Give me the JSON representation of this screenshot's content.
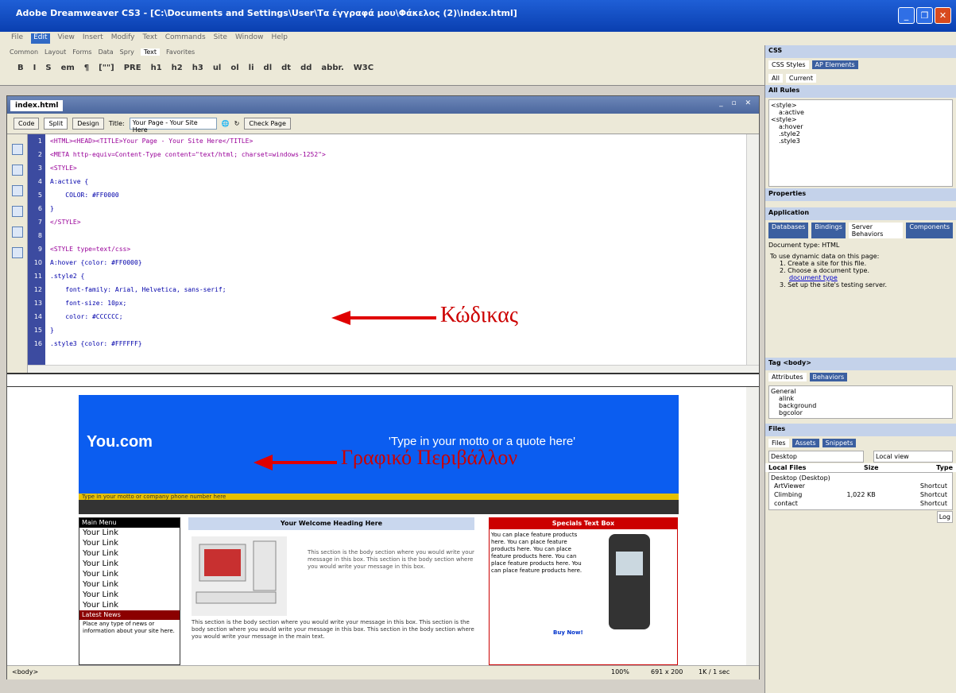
{
  "window": {
    "title": "Adobe Dreamweaver CS3 - [C:\\Documents and Settings\\User\\Τα έγγραφά μου\\Φάκελος (2)\\index.html]"
  },
  "menu": [
    "File",
    "Edit",
    "View",
    "Insert",
    "Modify",
    "Text",
    "Commands",
    "Site",
    "Window",
    "Help"
  ],
  "insert_tabs": [
    "Common",
    "Layout",
    "Forms",
    "Data",
    "Spry",
    "Text",
    "Favorites"
  ],
  "format_buttons": [
    "B",
    "I",
    "S",
    "em",
    "¶",
    "[\"\"]",
    "PRE",
    "h1",
    "h2",
    "h3",
    "ul",
    "ol",
    "li",
    "dl",
    "dt",
    "dd",
    "abbr.",
    "W3C"
  ],
  "document": {
    "tab": "index.html",
    "views": [
      "Code",
      "Split",
      "Design"
    ],
    "title_label": "Title:",
    "title_value": "Your Page - Your Site Here",
    "check_page": "Check Page"
  },
  "code": {
    "line_numbers": [
      "1",
      "2",
      "3",
      "4",
      "5",
      "6",
      "7",
      "8",
      "9",
      "10",
      "11",
      "12",
      "13",
      "14",
      "15",
      "16"
    ],
    "lines": [
      "<HTML><HEAD><TITLE>Your Page - Your Site Here</TITLE>",
      "<META http-equiv=Content-Type content=\"text/html; charset=windows-1252\">",
      "<STYLE>",
      "A:active {",
      "    COLOR: #FF0000",
      "}",
      "</STYLE>",
      "",
      "<STYLE type=text/css>",
      "A:hover {color: #FF0000}",
      ".style2 {",
      "    font-family: Arial, Helvetica, sans-serif;",
      "    font-size: 10px;",
      "    color: #CCCCCC;",
      "}",
      ".style3 {color: #FFFFFF}"
    ],
    "annotation": "Κώδικας"
  },
  "design": {
    "site_name": "You.com",
    "motto": "'Type in your motto or a quote here'",
    "annotation": "Γραφικό Περιβάλλον",
    "yellow_text": "Type in your motto or company phone number here",
    "nav_header": "Main Menu",
    "nav_links": [
      "Your Link",
      "Your Link",
      "Your Link",
      "Your Link",
      "Your Link",
      "Your Link",
      "Your Link",
      "Your Link"
    ],
    "news_header": "Latest News",
    "news_text": "Place any type of news or information about your site here.",
    "welcome_header": "Your Welcome Heading Here",
    "welcome_text": "This section is the body section where you would write your message in this box. This section is the body section where you would write your message in this box.",
    "welcome_body": "This section is the body section where you would write your message in this box. This section is the body section where you would write your message in this box. This section in the body section where you would write your message in the main text.",
    "special_header": "Specials Text Box",
    "special_text": "You can place feature products here. You can place feature products here. You can place feature products here. You can place feature products here. You can place feature products here.",
    "buy_now": "Buy Now!",
    "special_text2": "You can place feature products here. You can"
  },
  "status": {
    "left": "<body>",
    "zoom": "100%",
    "size": "691 x 200",
    "weight": "1K / 1 sec"
  },
  "panels": {
    "css_header": "CSS",
    "css_tabs": [
      "CSS Styles",
      "AP Elements"
    ],
    "css_buttons": [
      "All",
      "Current"
    ],
    "all_rules_label": "All Rules",
    "rules": [
      "<style>",
      "a:active",
      "<style>",
      "a:hover",
      ".style2",
      ".style3"
    ],
    "properties_label": "Properties",
    "application_header": "Application",
    "app_tabs": [
      "Databases",
      "Bindings",
      "Server Behaviors",
      "Components"
    ],
    "doc_type": "Document type: HTML",
    "app_intro": "To use dynamic data on this page:",
    "app_steps": [
      "1. Create a site for this file.",
      "2. Choose a document type.",
      "3. Set up the site's testing server."
    ],
    "doc_type_link": "document type",
    "tag_header": "Tag <body>",
    "tag_tabs": [
      "Attributes",
      "Behaviors"
    ],
    "tag_group": "General",
    "tag_attrs": [
      "alink",
      "background",
      "bgcolor"
    ],
    "files_header": "Files",
    "files_tabs": [
      "Files",
      "Assets",
      "Snippets"
    ],
    "site_select": "Desktop",
    "view_select": "Local view",
    "local_files": "Local Files",
    "size_col": "Size",
    "type_col": "Type",
    "root": "Desktop (Desktop)",
    "file_rows": [
      {
        "name": "ArtViewer",
        "size": "",
        "type": "Shortcut"
      },
      {
        "name": "Climbing",
        "size": "1,022 KB",
        "type": "Shortcut"
      },
      {
        "name": "contact",
        "size": "",
        "type": "Shortcut"
      }
    ],
    "log_button": "Log"
  }
}
